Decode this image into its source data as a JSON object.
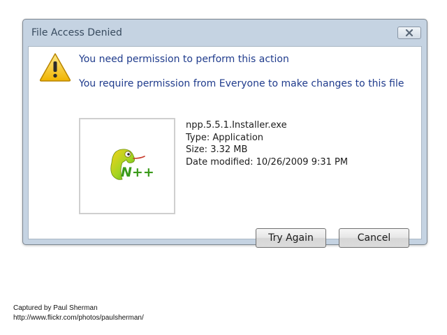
{
  "dialog": {
    "title": "File Access Denied",
    "close_icon": "close-icon",
    "warning_icon": "warning-icon",
    "heading": "You need permission to perform this action",
    "message": "You require permission from Everyone to make changes to this file",
    "file": {
      "icon": "notepad-plus-plus-icon",
      "name": "npp.5.5.1.Installer.exe",
      "type": "Type: Application",
      "size": "Size: 3.32 MB",
      "date_modified": "Date modified: 10/26/2009 9:31 PM"
    },
    "buttons": {
      "try_again": "Try Again",
      "cancel": "Cancel"
    }
  },
  "caption": {
    "credit": "Captured by Paul Sherman",
    "url": "http://www.flickr.com/photos/paulsherman/"
  },
  "colors": {
    "frame": "#c5d3e2",
    "heading_text": "#1f3b8c",
    "warning_yellow": "#f3c416"
  }
}
